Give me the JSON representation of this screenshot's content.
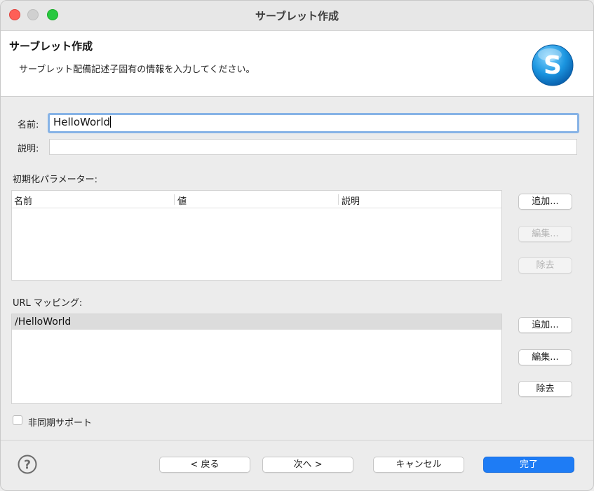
{
  "window": {
    "title": "サーブレット作成"
  },
  "header": {
    "title": "サーブレット作成",
    "description": "サーブレット配備記述子固有の情報を入力してください。"
  },
  "form": {
    "name_label": "名前:",
    "name_value": "HelloWorld",
    "description_label": "説明:",
    "description_value": ""
  },
  "init_params": {
    "label": "初期化パラメーター:",
    "columns": [
      "名前",
      "値",
      "説明"
    ],
    "rows": [],
    "buttons": {
      "add": "追加...",
      "edit": "編集...",
      "remove": "除去"
    }
  },
  "url_mappings": {
    "label": "URL マッピング:",
    "rows": [
      "/HelloWorld"
    ],
    "buttons": {
      "add": "追加...",
      "edit": "編集...",
      "remove": "除去"
    }
  },
  "async": {
    "label": "非同期サポート",
    "checked": false
  },
  "footer": {
    "back": "< 戻る",
    "next": "次へ >",
    "cancel": "キャンセル",
    "finish": "完了"
  },
  "colors": {
    "primary": "#1e7cf5",
    "focus_ring": "#87b3e6"
  },
  "icons": {
    "logo": "servlet-logo-icon",
    "help": "help-icon"
  }
}
